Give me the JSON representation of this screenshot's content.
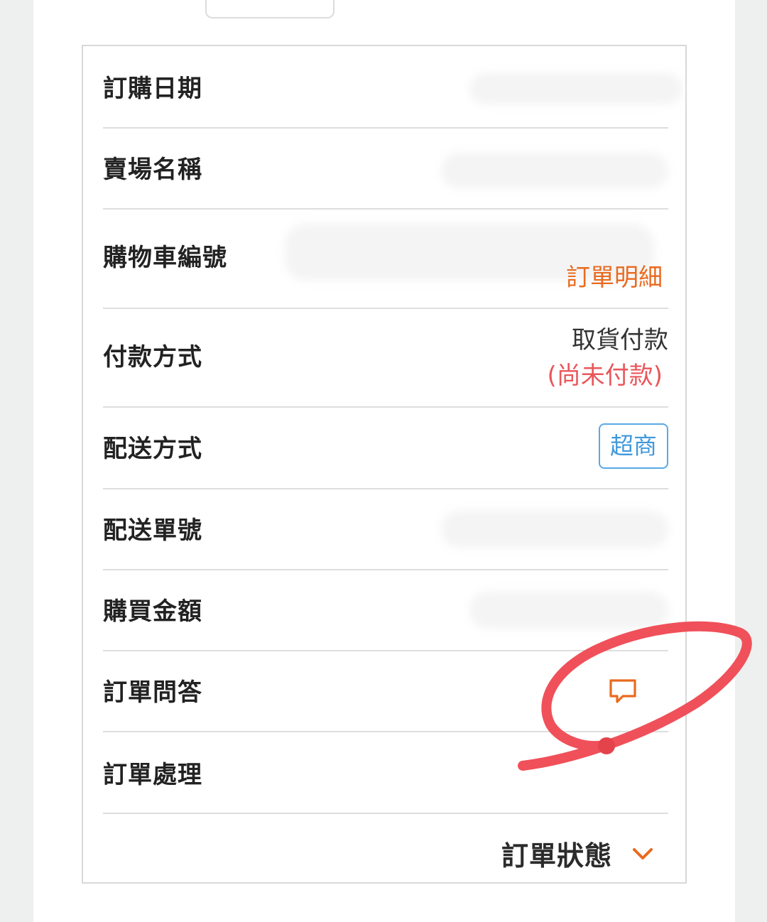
{
  "order": {
    "rows": [
      {
        "label": "訂購日期"
      },
      {
        "label": "賣場名稱"
      },
      {
        "label": "購物車編號",
        "link": "訂單明細"
      },
      {
        "label": "付款方式",
        "value": "取貨付款",
        "status": "(尚未付款)"
      },
      {
        "label": "配送方式",
        "badge": "超商"
      },
      {
        "label": "配送單號"
      },
      {
        "label": "購買金額"
      },
      {
        "label": "訂單問答",
        "icon": "chat-icon"
      },
      {
        "label": "訂單處理"
      }
    ],
    "status_toggle": {
      "label": "訂單狀態",
      "icon": "chevron-down-icon"
    }
  },
  "colors": {
    "accent_orange": "#e96a1f",
    "pay_status_red": "#e9565b",
    "badge_blue": "#3f98dc",
    "annotation_red": "#f0505a"
  }
}
